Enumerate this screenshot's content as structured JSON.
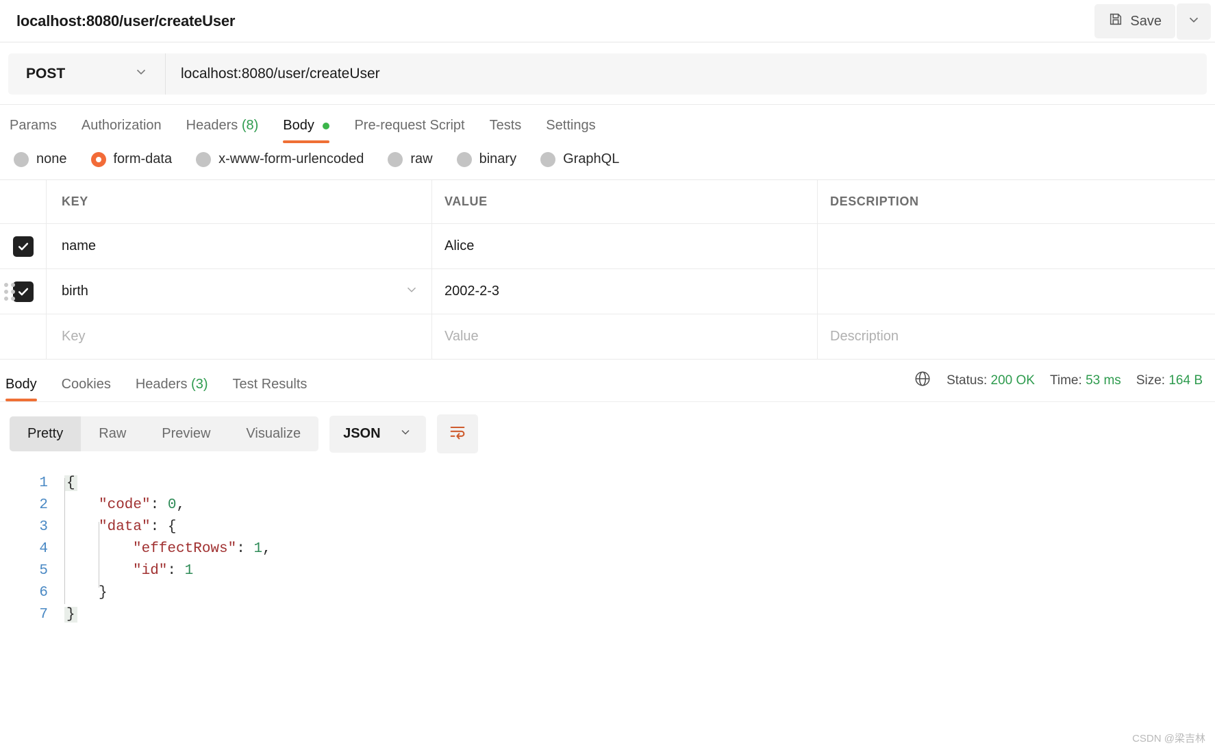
{
  "topbar": {
    "title": "localhost:8080/user/createUser",
    "save_label": "Save",
    "save_icon": "floppy-disk-icon",
    "caret_icon": "chevron-down-icon"
  },
  "request": {
    "method": "POST",
    "url": "localhost:8080/user/createUser",
    "tabs": [
      {
        "label": "Params",
        "active": false
      },
      {
        "label": "Authorization",
        "active": false
      },
      {
        "label": "Headers",
        "count": "(8)",
        "active": false
      },
      {
        "label": "Body",
        "active": true,
        "dot": true
      },
      {
        "label": "Pre-request Script",
        "active": false
      },
      {
        "label": "Tests",
        "active": false
      },
      {
        "label": "Settings",
        "active": false
      }
    ],
    "body_types": [
      {
        "label": "none",
        "checked": false
      },
      {
        "label": "form-data",
        "checked": true
      },
      {
        "label": "x-www-form-urlencoded",
        "checked": false
      },
      {
        "label": "raw",
        "checked": false
      },
      {
        "label": "binary",
        "checked": false
      },
      {
        "label": "GraphQL",
        "checked": false
      }
    ],
    "table": {
      "columns": [
        "KEY",
        "VALUE",
        "DESCRIPTION"
      ],
      "rows": [
        {
          "checked": true,
          "key": "name",
          "value": "Alice",
          "description": ""
        },
        {
          "checked": true,
          "key": "birth",
          "value": "2002-2-3",
          "description": ""
        }
      ],
      "placeholder_row": {
        "key": "Key",
        "value": "Value",
        "description": "Description"
      }
    }
  },
  "response": {
    "tabs": [
      {
        "label": "Body",
        "active": true
      },
      {
        "label": "Cookies",
        "active": false
      },
      {
        "label": "Headers",
        "count": "(3)",
        "active": false
      },
      {
        "label": "Test Results",
        "active": false
      }
    ],
    "meta": {
      "globe_icon": "globe-icon",
      "status_label": "Status:",
      "status_value": "200 OK",
      "time_label": "Time:",
      "time_value": "53 ms",
      "size_label": "Size:",
      "size_value": "164 B"
    },
    "view_modes": [
      {
        "label": "Pretty",
        "active": true
      },
      {
        "label": "Raw",
        "active": false
      },
      {
        "label": "Preview",
        "active": false
      },
      {
        "label": "Visualize",
        "active": false
      }
    ],
    "format": "JSON",
    "format_caret_icon": "chevron-down-icon",
    "wrap_icon": "wrap-lines-icon",
    "code": {
      "line_numbers": [
        "1",
        "2",
        "3",
        "4",
        "5",
        "6",
        "7"
      ],
      "lines": [
        "{",
        "    \"code\": 0,",
        "    \"data\": {",
        "        \"effectRows\": 1,",
        "        \"id\": 1",
        "    }",
        "}"
      ],
      "tokens": {
        "l1_brace": "{",
        "l2_key": "\"code\"",
        "l2_colon": ": ",
        "l2_num": "0",
        "l2_comma": ",",
        "l3_key": "\"data\"",
        "l3_colon": ": ",
        "l3_brace": "{",
        "l4_key": "\"effectRows\"",
        "l4_colon": ": ",
        "l4_num": "1",
        "l4_comma": ",",
        "l5_key": "\"id\"",
        "l5_colon": ": ",
        "l5_num": "1",
        "l6_brace": "}",
        "l7_brace": "}"
      }
    }
  },
  "footer": {
    "watermark": "CSDN @梁吉林"
  },
  "colors": {
    "accent_orange": "#ef7035",
    "status_green": "#2e9b4e",
    "json_key": "#a03030",
    "json_number": "#2e8b57",
    "line_number": "#4a89c4"
  }
}
